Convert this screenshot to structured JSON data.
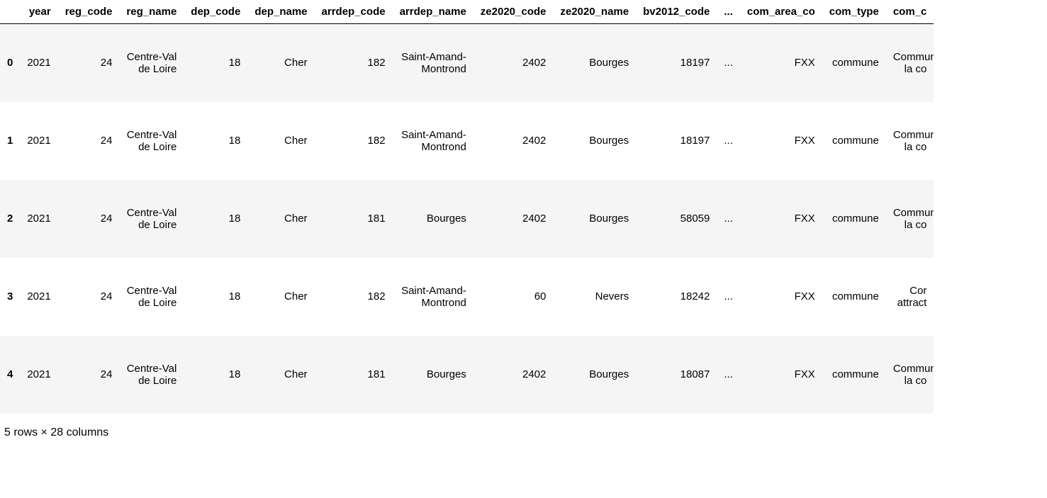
{
  "columns": [
    "year",
    "reg_code",
    "reg_name",
    "dep_code",
    "dep_name",
    "arrdep_code",
    "arrdep_name",
    "ze2020_code",
    "ze2020_name",
    "bv2012_code",
    "...",
    "com_area_co",
    "com_type",
    "com_c"
  ],
  "rows": [
    {
      "idx": "0",
      "year": "2021",
      "reg_code": "24",
      "reg_name": "Centre-Val de Loire",
      "dep_code": "18",
      "dep_name": "Cher",
      "arrdep_code": "182",
      "arrdep_name": "Saint-Amand-Montrond",
      "ze2020_code": "2402",
      "ze2020_name": "Bourges",
      "bv2012_code": "18197",
      "ell": "...",
      "com_area_co": "FXX",
      "com_type": "commune",
      "com_c": "Commune la co"
    },
    {
      "idx": "1",
      "year": "2021",
      "reg_code": "24",
      "reg_name": "Centre-Val de Loire",
      "dep_code": "18",
      "dep_name": "Cher",
      "arrdep_code": "182",
      "arrdep_name": "Saint-Amand-Montrond",
      "ze2020_code": "2402",
      "ze2020_name": "Bourges",
      "bv2012_code": "18197",
      "ell": "...",
      "com_area_co": "FXX",
      "com_type": "commune",
      "com_c": "Commune la co"
    },
    {
      "idx": "2",
      "year": "2021",
      "reg_code": "24",
      "reg_name": "Centre-Val de Loire",
      "dep_code": "18",
      "dep_name": "Cher",
      "arrdep_code": "181",
      "arrdep_name": "Bourges",
      "ze2020_code": "2402",
      "ze2020_name": "Bourges",
      "bv2012_code": "58059",
      "ell": "...",
      "com_area_co": "FXX",
      "com_type": "commune",
      "com_c": "Commune la co"
    },
    {
      "idx": "3",
      "year": "2021",
      "reg_code": "24",
      "reg_name": "Centre-Val de Loire",
      "dep_code": "18",
      "dep_name": "Cher",
      "arrdep_code": "182",
      "arrdep_name": "Saint-Amand-Montrond",
      "ze2020_code": "60",
      "ze2020_name": "Nevers",
      "bv2012_code": "18242",
      "ell": "...",
      "com_area_co": "FXX",
      "com_type": "commune",
      "com_c": "Cor attract"
    },
    {
      "idx": "4",
      "year": "2021",
      "reg_code": "24",
      "reg_name": "Centre-Val de Loire",
      "dep_code": "18",
      "dep_name": "Cher",
      "arrdep_code": "181",
      "arrdep_name": "Bourges",
      "ze2020_code": "2402",
      "ze2020_name": "Bourges",
      "bv2012_code": "18087",
      "ell": "...",
      "com_area_co": "FXX",
      "com_type": "commune",
      "com_c": "Commune la co"
    }
  ],
  "summary": "5 rows × 28 columns"
}
